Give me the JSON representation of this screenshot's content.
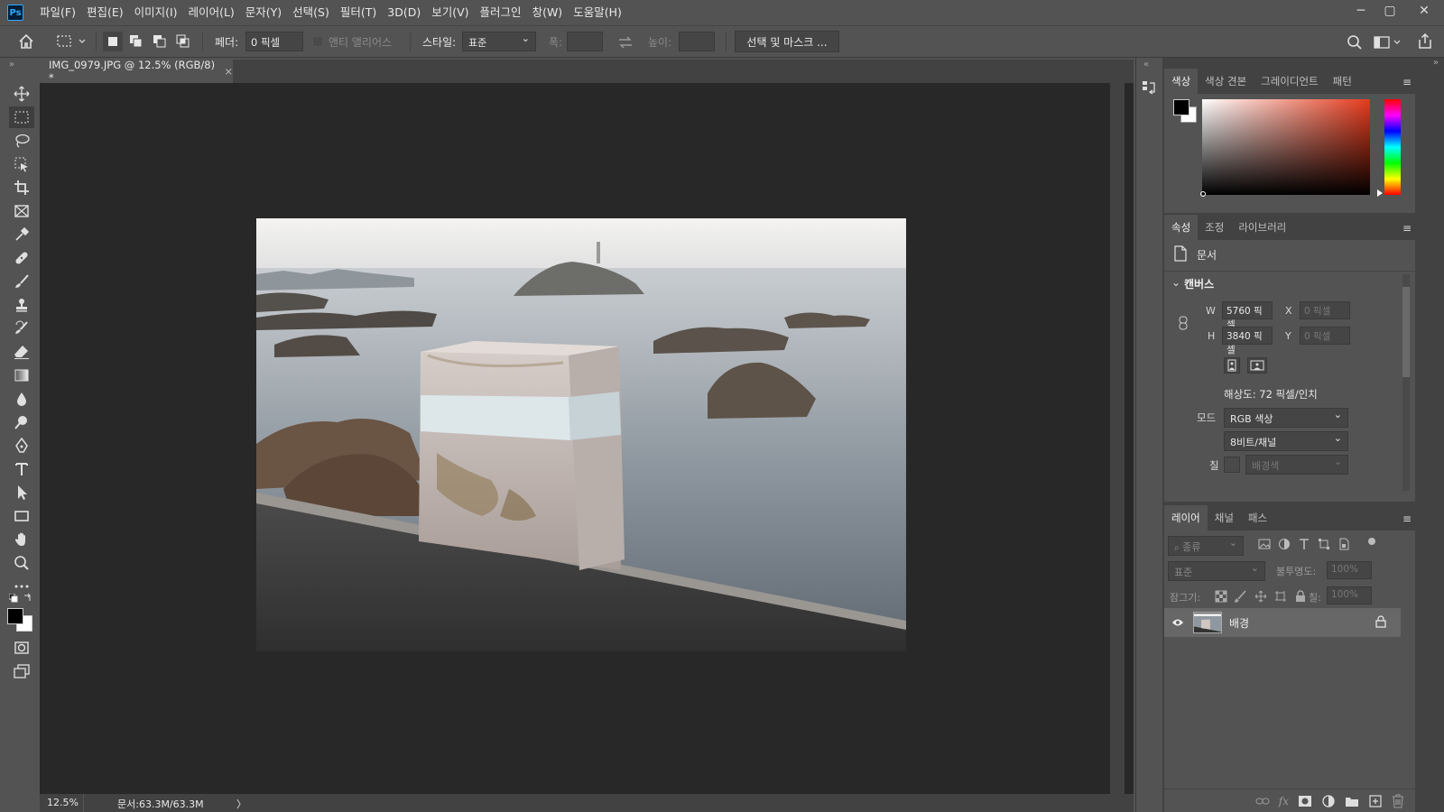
{
  "app": {
    "logo_text": "Ps"
  },
  "menu": [
    "파일(F)",
    "편집(E)",
    "이미지(I)",
    "레이어(L)",
    "문자(Y)",
    "선택(S)",
    "필터(T)",
    "3D(D)",
    "보기(V)",
    "플러그인",
    "창(W)",
    "도움말(H)"
  ],
  "window_controls": {
    "minimize": "─",
    "maximize": "▢",
    "close": "✕"
  },
  "options": {
    "feather_label": "페더:",
    "feather_value": "0 픽셀",
    "antialias_label": "앤티 앨리어스",
    "style_label": "스타일:",
    "style_value": "표준",
    "width_label": "폭:",
    "height_label": "높이:",
    "select_mask_label": "선택 및 마스크 ..."
  },
  "document": {
    "tab_title": "IMG_0979.JPG @ 12.5% (RGB/8) *",
    "close": "×",
    "zoom": "12.5%",
    "doc_info": "문서:63.3M/63.3M",
    "status_arrow": "〉"
  },
  "colors": {
    "foreground": "#000000",
    "background": "#ffffff",
    "ui_bg": "#535353",
    "canvas_bg": "#282828",
    "panel_bg": "#424242"
  },
  "color_panel": {
    "tabs": [
      "색상",
      "색상 견본",
      "그레이디언트",
      "패턴"
    ],
    "active_tab": 0
  },
  "properties_panel": {
    "tabs": [
      "속성",
      "조정",
      "라이브러리"
    ],
    "active_tab": 0,
    "doc_label": "문서",
    "section_title": "캔버스",
    "w_label": "W",
    "w_value": "5760 픽셀",
    "h_label": "H",
    "h_value": "3840 픽셀",
    "x_label": "X",
    "x_placeholder": "0 픽셀",
    "y_label": "Y",
    "y_placeholder": "0 픽셀",
    "resolution": "해상도: 72 픽셀/인치",
    "mode_label": "모드",
    "mode_value": "RGB 색상",
    "depth_value": "8비트/채널",
    "fill_label": "칠",
    "fill_value": "배경색"
  },
  "layers_panel": {
    "tabs": [
      "레이어",
      "채널",
      "패스"
    ],
    "active_tab": 0,
    "filter_placeholder": "종류",
    "blend_mode": "표준",
    "opacity_label": "불투명도:",
    "opacity_value": "100%",
    "lock_label": "잠그기:",
    "fill_label": "칠:",
    "fill_value": "100%",
    "layers": [
      {
        "name": "배경",
        "visible": true,
        "locked": true
      }
    ]
  }
}
